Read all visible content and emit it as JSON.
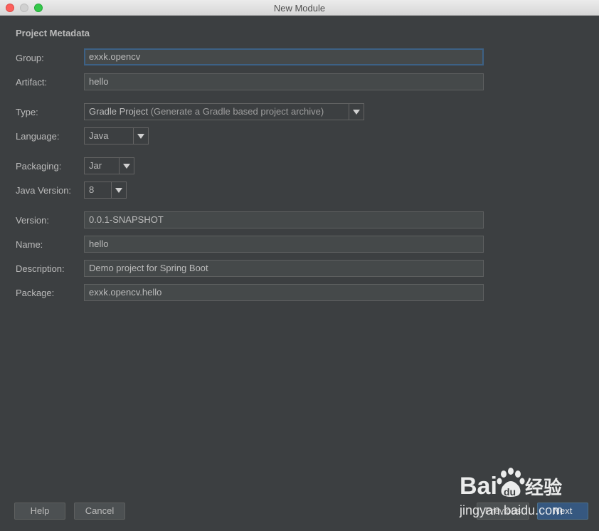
{
  "window": {
    "title": "New Module"
  },
  "section": {
    "title": "Project Metadata"
  },
  "form": {
    "group": {
      "label": "Group:",
      "value": "exxk.opencv"
    },
    "artifact": {
      "label": "Artifact:",
      "value": "hello"
    },
    "type": {
      "label": "Type:",
      "value": "Gradle Project",
      "hint": "(Generate a Gradle based project archive)"
    },
    "language": {
      "label": "Language:",
      "value": "Java"
    },
    "packaging": {
      "label": "Packaging:",
      "value": "Jar"
    },
    "java_version": {
      "label": "Java Version:",
      "value": "8"
    },
    "version": {
      "label": "Version:",
      "value": "0.0.1-SNAPSHOT"
    },
    "name": {
      "label": "Name:",
      "value": "hello"
    },
    "description": {
      "label": "Description:",
      "value": "Demo project for Spring Boot"
    },
    "package": {
      "label": "Package:",
      "value": "exxk.opencv.hello"
    }
  },
  "buttons": {
    "help": "Help",
    "cancel": "Cancel",
    "previous": "Previous",
    "next": "Next"
  },
  "watermark": {
    "text": "jingyan.baidu.com"
  },
  "colors": {
    "background": "#3c3f41",
    "field": "#45494a",
    "focus": "#3d6185",
    "primary": "#365880"
  }
}
